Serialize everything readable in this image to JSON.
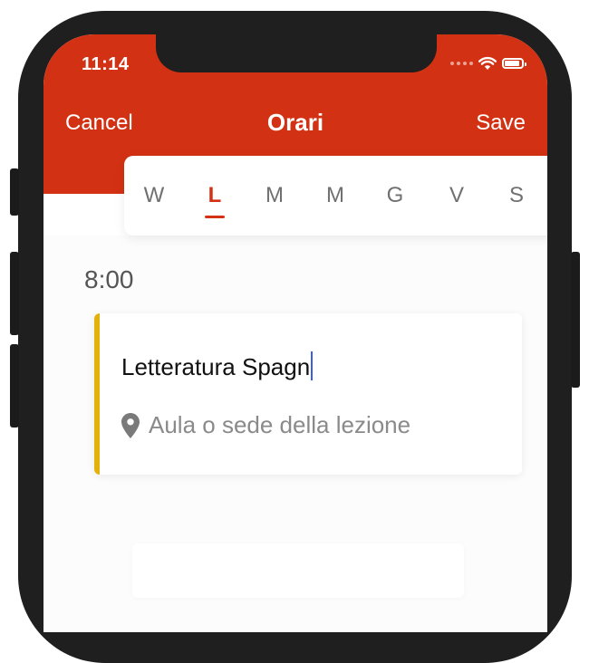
{
  "status_bar": {
    "time": "11:14"
  },
  "nav": {
    "cancel_label": "Cancel",
    "title": "Orari",
    "save_label": "Save"
  },
  "days": [
    {
      "label": "W",
      "active": false
    },
    {
      "label": "L",
      "active": true
    },
    {
      "label": "M",
      "active": false
    },
    {
      "label": "M",
      "active": false
    },
    {
      "label": "G",
      "active": false
    },
    {
      "label": "V",
      "active": false
    },
    {
      "label": "S",
      "active": false
    }
  ],
  "schedule": {
    "time_slot": "8:00",
    "lesson": {
      "title": "Letteratura Spagn",
      "location_placeholder": "Aula o sede della lezione",
      "accent_color": "#e3b10b"
    }
  },
  "colors": {
    "brand": "#d33113",
    "cursor": "#3a60e0"
  },
  "icons": [
    "signal-icon",
    "wifi-icon",
    "battery-icon",
    "location-pin-icon"
  ]
}
